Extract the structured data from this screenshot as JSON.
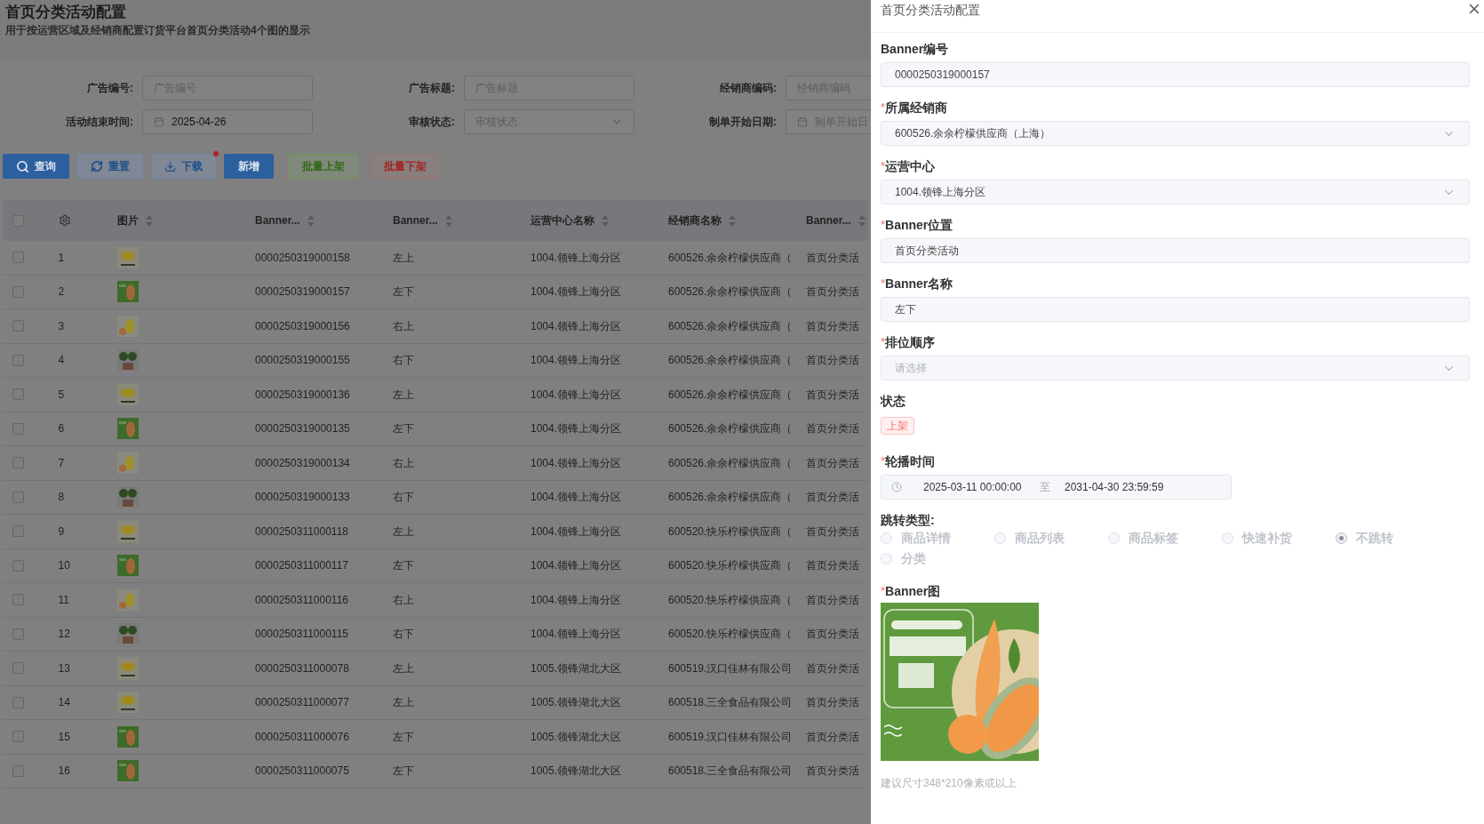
{
  "page": {
    "title": "首页分类活动配置",
    "subtitle": "用于按运营区域及经销商配置订货平台首页分类活动4个图的显示"
  },
  "filters": [
    {
      "label": "广告编号:",
      "kind": "text",
      "placeholder": "广告编号"
    },
    {
      "label": "广告标题:",
      "kind": "text",
      "placeholder": "广告标题"
    },
    {
      "label": "经销商编码:",
      "kind": "text",
      "placeholder": "经销商编码"
    },
    {
      "label": "活动结束时间:",
      "kind": "date",
      "value": "2025-04-26"
    },
    {
      "label": "审核状态:",
      "kind": "select",
      "placeholder": "审核状态"
    },
    {
      "label": "制单开始日期:",
      "kind": "date",
      "placeholder": "制单开始日"
    }
  ],
  "buttons": [
    {
      "label": "查询",
      "kind": "primary",
      "dot": false
    },
    {
      "label": "重置",
      "kind": "outline",
      "dot": false
    },
    {
      "label": "下载",
      "kind": "outline",
      "dot": true
    },
    {
      "label": "新增",
      "kind": "primary",
      "dot": false
    },
    {
      "label": "批量上架",
      "kind": "success",
      "dot": false
    },
    {
      "label": "批量下架",
      "kind": "danger",
      "dot": false
    }
  ],
  "table": {
    "header_checked": false,
    "columns": [
      "图片",
      "Banner...",
      "Banner...",
      "运营中心名称",
      "经销商名称",
      "Banner..."
    ],
    "rows": [
      {
        "checked": false,
        "index": "1",
        "id": "0000250319000158",
        "name": "左上",
        "center": "1004.领锋上海分区",
        "dealer": "600526.余余柠檬供应商（",
        "column_7": "首页分类活"
      },
      {
        "checked": false,
        "index": "2",
        "id": "0000250319000157",
        "name": "左下",
        "center": "1004.领锋上海分区",
        "dealer": "600526.余余柠檬供应商（",
        "column_7": "首页分类活"
      },
      {
        "checked": false,
        "index": "3",
        "id": "0000250319000156",
        "name": "右上",
        "center": "1004.领锋上海分区",
        "dealer": "600526.余余柠檬供应商（",
        "column_7": "首页分类活"
      },
      {
        "checked": false,
        "index": "4",
        "id": "0000250319000155",
        "name": "右下",
        "center": "1004.领锋上海分区",
        "dealer": "600526.余余柠檬供应商（",
        "column_7": "首页分类活"
      },
      {
        "checked": false,
        "index": "5",
        "id": "0000250319000136",
        "name": "左上",
        "center": "1004.领锋上海分区",
        "dealer": "600526.余余柠檬供应商（",
        "column_7": "首页分类活"
      },
      {
        "checked": false,
        "index": "6",
        "id": "0000250319000135",
        "name": "左下",
        "center": "1004.领锋上海分区",
        "dealer": "600526.余余柠檬供应商（",
        "column_7": "首页分类活"
      },
      {
        "checked": false,
        "index": "7",
        "id": "0000250319000134",
        "name": "右上",
        "center": "1004.领锋上海分区",
        "dealer": "600526.余余柠檬供应商（",
        "column_7": "首页分类活"
      },
      {
        "checked": false,
        "index": "8",
        "id": "0000250319000133",
        "name": "右下",
        "center": "1004.领锋上海分区",
        "dealer": "600526.余余柠檬供应商（",
        "column_7": "首页分类活"
      },
      {
        "checked": false,
        "index": "9",
        "id": "0000250311000118",
        "name": "左上",
        "center": "1004.领锋上海分区",
        "dealer": "600520.快乐柠檬供应商（",
        "column_7": "首页分类活"
      },
      {
        "checked": false,
        "index": "10",
        "id": "0000250311000117",
        "name": "左下",
        "center": "1004.领锋上海分区",
        "dealer": "600520.快乐柠檬供应商（",
        "column_7": "首页分类活"
      },
      {
        "checked": false,
        "index": "11",
        "id": "0000250311000116",
        "name": "右上",
        "center": "1004.领锋上海分区",
        "dealer": "600520.快乐柠檬供应商（",
        "column_7": "首页分类活"
      },
      {
        "checked": false,
        "index": "12",
        "id": "0000250311000115",
        "name": "右下",
        "center": "1004.领锋上海分区",
        "dealer": "600520.快乐柠檬供应商（",
        "column_7": "首页分类活"
      },
      {
        "checked": false,
        "index": "13",
        "id": "0000250311000078",
        "name": "左上",
        "center": "1005.领锋湖北大区",
        "dealer": "600519.汉口佳林有限公司",
        "column_7": "首页分类活"
      },
      {
        "checked": false,
        "index": "14",
        "id": "0000250311000077",
        "name": "左上",
        "center": "1005.领锋湖北大区",
        "dealer": "600518.三全食品有限公司",
        "column_7": "首页分类活"
      },
      {
        "checked": false,
        "index": "15",
        "id": "0000250311000076",
        "name": "左下",
        "center": "1005.领锋湖北大区",
        "dealer": "600519.汉口佳林有限公司",
        "column_7": "首页分类活"
      },
      {
        "checked": false,
        "index": "16",
        "id": "0000250311000075",
        "name": "左下",
        "center": "1005.领锋湖北大区",
        "dealer": "600518.三全食品有限公司",
        "column_7": "首页分类活"
      }
    ]
  },
  "drawer": {
    "title": "首页分类活动配置",
    "fields": [
      {
        "label": "Banner编号",
        "kind": "input",
        "value": "0000250319000157"
      },
      {
        "required_mark": "*",
        "label": "所属经销商",
        "kind": "select",
        "value": "600526.余余柠檬供应商（上海）"
      },
      {
        "required_mark": "*",
        "label": "运营中心",
        "kind": "select",
        "value": "1004.领锋上海分区"
      },
      {
        "required_mark": "*",
        "label": "Banner位置",
        "kind": "input",
        "value": "首页分类活动"
      },
      {
        "required_mark": "*",
        "label": "Banner名称",
        "kind": "input",
        "value": "左下"
      },
      {
        "required_mark": "*",
        "label": "排位顺序",
        "kind": "select",
        "placeholder": "请选择"
      }
    ],
    "status": {
      "label": "状态",
      "tag": "上架"
    },
    "time": {
      "required_mark": "*",
      "label": "轮播时间",
      "start": "2025-03-11 00:00:00",
      "separator": "至",
      "end": "2031-04-30 23:59:59"
    },
    "jump": {
      "label": "跳转类型:",
      "disabled": true,
      "options": [
        {
          "label": "商品详情",
          "selected": false
        },
        {
          "label": "商品列表",
          "selected": false
        },
        {
          "label": "商品标签",
          "selected": false
        },
        {
          "label": "快速补货",
          "selected": false
        },
        {
          "label": "不跳转",
          "selected": true
        },
        {
          "label": "分类",
          "selected": false
        }
      ]
    },
    "image": {
      "required_mark": "*",
      "label": "Banner图",
      "kind": "picture"
    },
    "hint": "建议尺寸348*210像素或以上"
  }
}
